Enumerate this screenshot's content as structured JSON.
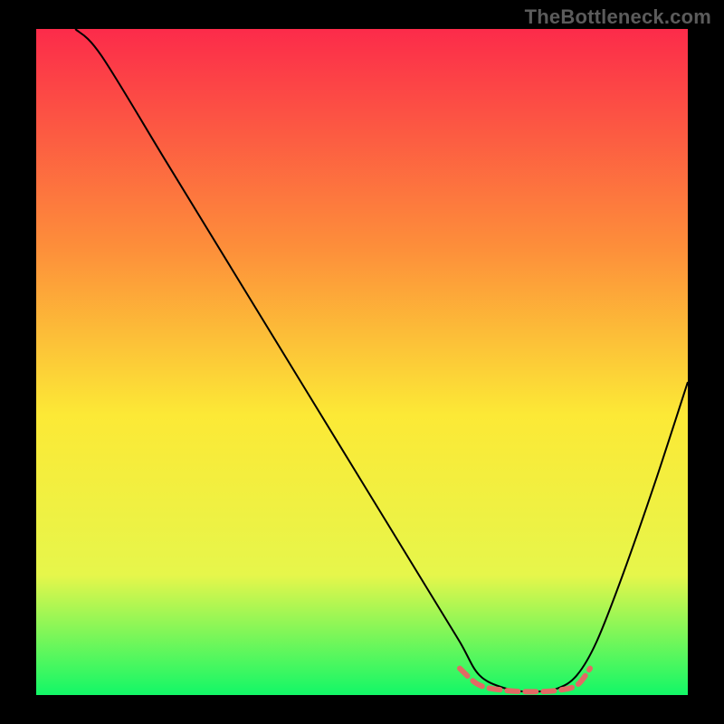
{
  "watermark": "TheBottleneck.com",
  "chart_data": {
    "type": "line",
    "title": "",
    "xlabel": "",
    "ylabel": "",
    "xlim": [
      0,
      100
    ],
    "ylim": [
      0,
      100
    ],
    "grid": false,
    "legend": false,
    "background_gradient": {
      "top": "#fc2b4a",
      "mid_upper": "#fd8f3a",
      "mid": "#fce936",
      "mid_lower": "#e6f64b",
      "bottom": "#12f767"
    },
    "series": [
      {
        "name": "curve",
        "color": "#000000",
        "stroke_width": 2,
        "x": [
          6,
          10,
          20,
          30,
          40,
          50,
          60,
          65,
          68,
          72,
          76,
          80,
          83,
          86,
          90,
          95,
          100
        ],
        "y": [
          100,
          96,
          80,
          64,
          48,
          32,
          16,
          8,
          3,
          1,
          0.5,
          1,
          3,
          8,
          18,
          32,
          47
        ]
      },
      {
        "name": "flat-highlight",
        "type": "dashed",
        "color": "#e26a64",
        "stroke_width": 6,
        "dash": "12 8",
        "x": [
          65,
          68,
          72,
          76,
          80,
          83,
          85
        ],
        "y": [
          4,
          1.5,
          0.7,
          0.5,
          0.7,
          1.5,
          4
        ]
      }
    ]
  }
}
